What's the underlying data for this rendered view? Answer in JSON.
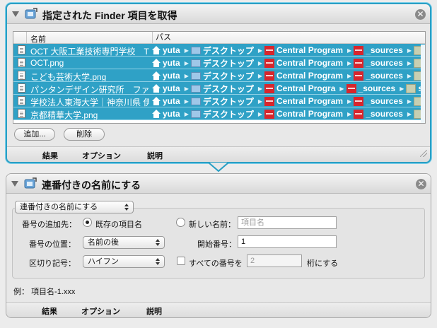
{
  "action1": {
    "title": "指定された Finder 項目を取得",
    "columns": {
      "name": "名前",
      "path": "パス"
    },
    "rows": [
      {
        "name": "OCT 大阪工業技術専門学校　TO",
        "path": [
          "yuta",
          "デスクトップ",
          "Central Program",
          "_sources"
        ]
      },
      {
        "name": "OCT.png",
        "path": [
          "yuta",
          "デスクトップ",
          "Central Program",
          "_sources"
        ]
      },
      {
        "name": "こども芸術大学.png",
        "path": [
          "yuta",
          "デスクトップ",
          "Central Program",
          "_sources"
        ]
      },
      {
        "name": "パンタンデザイン研究所　ファッ",
        "path": [
          "yuta",
          "デスクトップ",
          "Central Progra",
          "_sources",
          "so"
        ]
      },
      {
        "name": "学校法人東海大学｜神奈川県 伊勢",
        "path": [
          "yuta",
          "デスクトップ",
          "Central Program",
          "_sources"
        ]
      },
      {
        "name": "京都精華大学.png",
        "path": [
          "yuta",
          "デスクトップ",
          "Central Program",
          "_sources"
        ]
      }
    ],
    "add_label": "追加...",
    "delete_label": "削除",
    "footer": {
      "results": "結果",
      "options": "オプション",
      "description": "説明"
    },
    "accent": "#2fa1c6"
  },
  "action2": {
    "title": "連番付きの名前にする",
    "mode": "連番付きの名前にする",
    "add_number_to_label": "番号の追加先：",
    "existing_name_label": "既存の項目名",
    "new_name_label": "新しい名前：",
    "new_name_placeholder": "項目名",
    "position_label": "番号の位置：",
    "position_value": "名前の後",
    "start_label": "開始番号：",
    "start_value": "1",
    "separator_label": "区切り記号：",
    "separator_value": "ハイフン",
    "all_numbers_label": "すべての番号を",
    "digits_value": "2",
    "digits_suffix": "桁にする",
    "example": "例：  項目名-1.xxx",
    "footer": {
      "results": "結果",
      "options": "オプション",
      "description": "説明"
    }
  }
}
